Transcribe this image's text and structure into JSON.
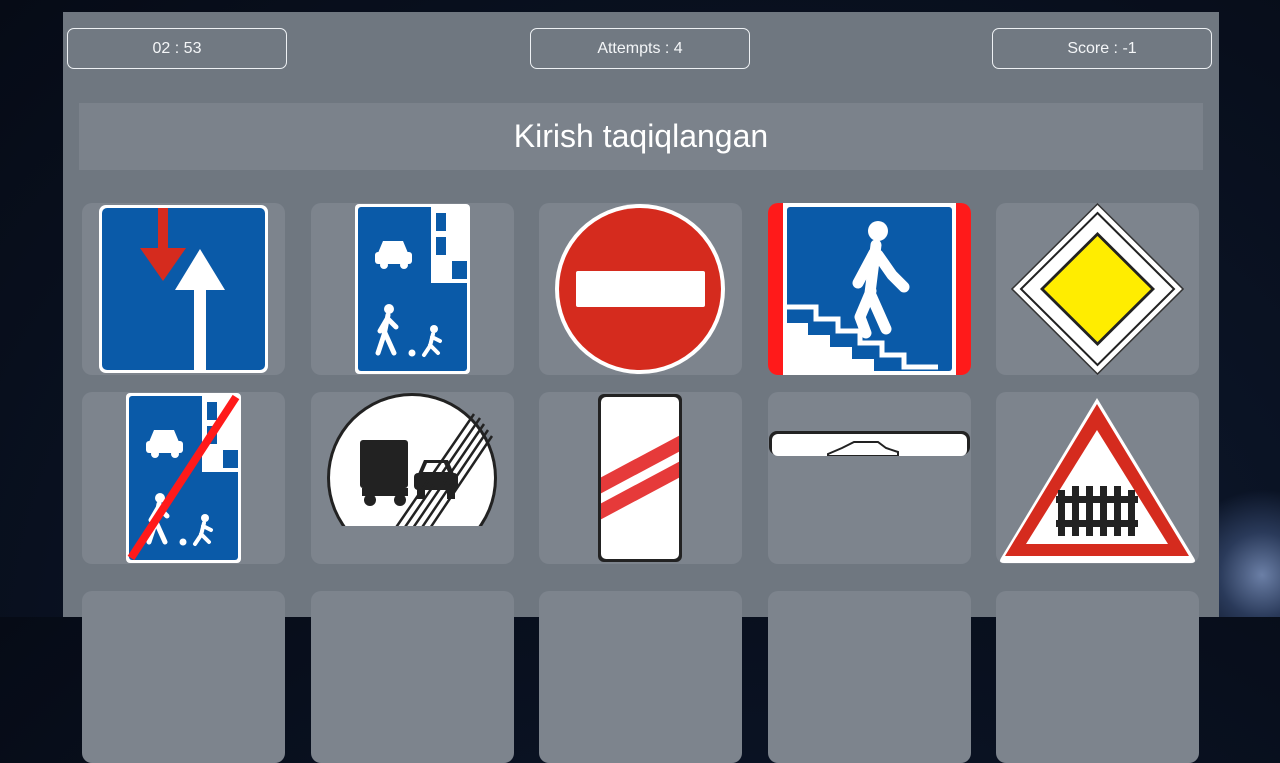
{
  "hud": {
    "timer": "02 : 53",
    "attempts": "Attempts : 4",
    "score": "Score : -1"
  },
  "question": "Kirish taqiqlangan",
  "colors": {
    "panel": "#6f7780",
    "cell": "#7d848d",
    "sign_blue": "#0a5aa8",
    "sign_red": "#d52b1e",
    "sign_yellow": "#ffed00"
  },
  "cards": [
    {
      "icon": "priority-over-oncoming-sign-icon"
    },
    {
      "icon": "living-zone-sign-icon"
    },
    {
      "icon": "no-entry-sign-icon"
    },
    {
      "icon": "underground-crossing-sign-icon"
    },
    {
      "icon": "priority-road-sign-icon"
    },
    {
      "icon": "end-of-living-zone-sign-icon"
    },
    {
      "icon": "end-of-no-overtaking-trucks-sign-icon"
    },
    {
      "icon": "railway-crossing-approach-sign-icon"
    },
    {
      "icon": "loading-sign-icon"
    },
    {
      "icon": "railway-crossing-with-barrier-sign-icon"
    },
    {
      "icon": ""
    },
    {
      "icon": ""
    },
    {
      "icon": ""
    },
    {
      "icon": ""
    },
    {
      "icon": ""
    }
  ]
}
